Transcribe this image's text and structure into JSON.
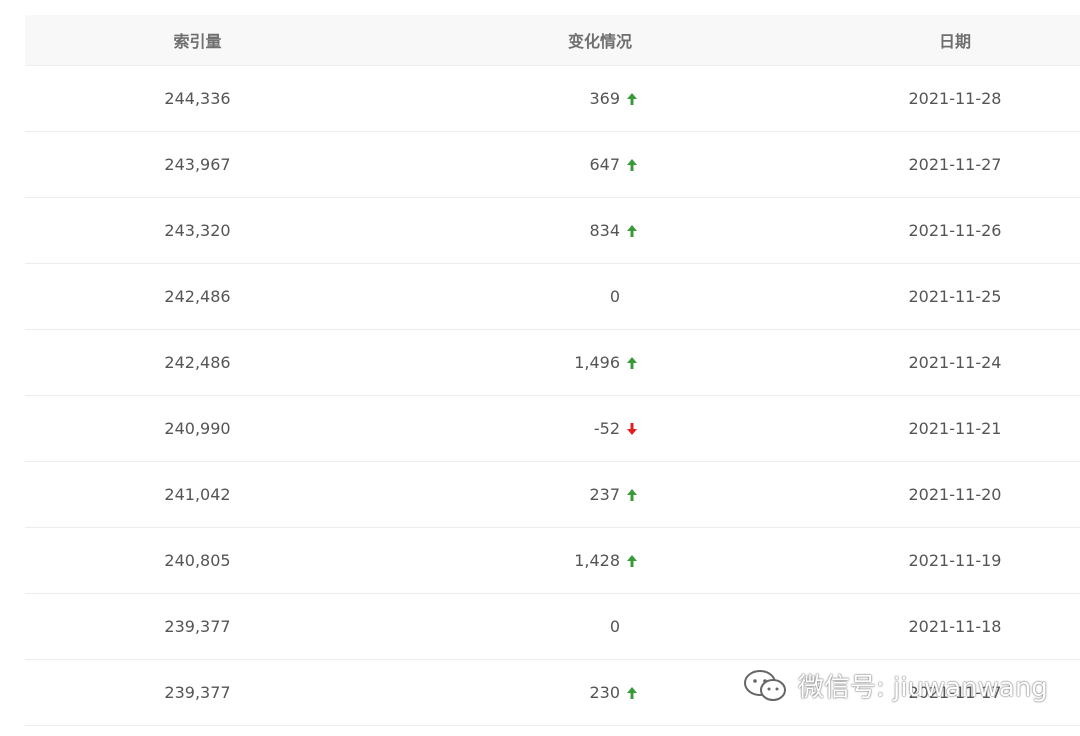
{
  "table": {
    "headers": {
      "index": "索引量",
      "change": "变化情况",
      "date": "日期"
    },
    "rows": [
      {
        "index": "244,336",
        "change": "369",
        "dir": "up",
        "date": "2021-11-28"
      },
      {
        "index": "243,967",
        "change": "647",
        "dir": "up",
        "date": "2021-11-27"
      },
      {
        "index": "243,320",
        "change": "834",
        "dir": "up",
        "date": "2021-11-26"
      },
      {
        "index": "242,486",
        "change": "0",
        "dir": "none",
        "date": "2021-11-25"
      },
      {
        "index": "242,486",
        "change": "1,496",
        "dir": "up",
        "date": "2021-11-24"
      },
      {
        "index": "240,990",
        "change": "-52",
        "dir": "down",
        "date": "2021-11-21"
      },
      {
        "index": "241,042",
        "change": "237",
        "dir": "up",
        "date": "2021-11-20"
      },
      {
        "index": "240,805",
        "change": "1,428",
        "dir": "up",
        "date": "2021-11-19"
      },
      {
        "index": "239,377",
        "change": "0",
        "dir": "none",
        "date": "2021-11-18"
      },
      {
        "index": "239,377",
        "change": "230",
        "dir": "up",
        "date": "2021-11-17"
      }
    ]
  },
  "colors": {
    "up": "#3a9a3a",
    "down": "#e02020"
  },
  "icons": {
    "up": "arrow-up-icon",
    "down": "arrow-down-icon",
    "watermark": "wechat-icon"
  },
  "watermark": {
    "text": "微信号: jiuwanwang"
  }
}
